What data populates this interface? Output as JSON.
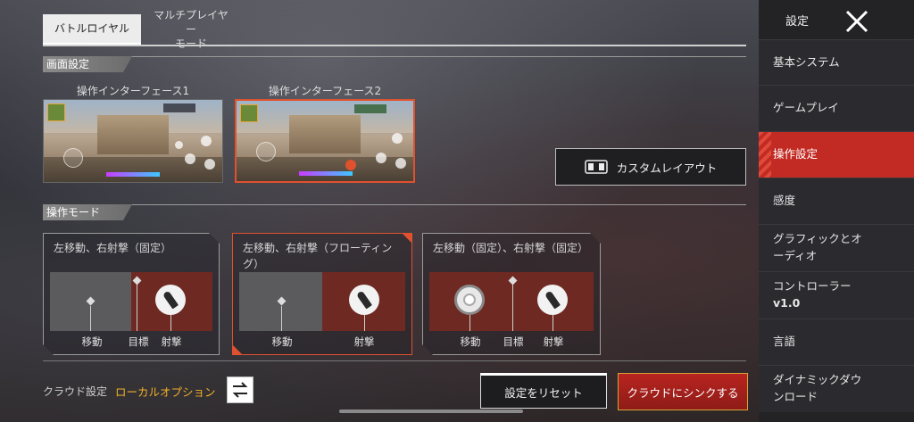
{
  "tabs": [
    {
      "label": "バトルロイヤル",
      "active": true
    },
    {
      "label": "マルチプレイヤー\nモード",
      "active": false
    }
  ],
  "sections": {
    "display": "画面設定",
    "mode": "操作モード"
  },
  "interfaces": [
    {
      "title": "操作インターフェース1",
      "selected": false
    },
    {
      "title": "操作インターフェース2",
      "selected": true
    }
  ],
  "custom_layout": {
    "label": "カスタムレイアウト",
    "icon": "controller-layout-icon"
  },
  "modes": [
    {
      "title": "左移動、右射撃（固定）",
      "selected": false,
      "labels": [
        "移動",
        "目標",
        "射撃"
      ]
    },
    {
      "title": "左移動、右射撃（フローティング）",
      "selected": true,
      "labels": [
        "移動",
        "射撃"
      ]
    },
    {
      "title": "左移動（固定）、右射撃（固定）",
      "selected": false,
      "labels": [
        "移動",
        "目標",
        "射撃"
      ]
    }
  ],
  "cloud": {
    "label": "クラウド設定",
    "value": "ローカルオプション",
    "swap_icon": "swap-arrows-icon"
  },
  "buttons": {
    "reset": "設定をリセット",
    "sync": "クラウドにシンクする"
  },
  "sidebar": {
    "title": "設定",
    "close_icon": "close-icon",
    "items": [
      {
        "label": "基本システム",
        "active": false
      },
      {
        "label": "ゲームプレイ",
        "active": false
      },
      {
        "label": "操作設定",
        "active": true
      },
      {
        "label": "感度",
        "active": false
      },
      {
        "label": "グラフィックとオ\nーディオ",
        "active": false
      },
      {
        "label": "コントローラー",
        "sub": "v1.0",
        "active": false
      },
      {
        "label": "言語",
        "active": false
      },
      {
        "label": "ダイナミックダウ\nンロード",
        "active": false
      }
    ]
  },
  "colors": {
    "accent_red": "#c22b23",
    "highlight_orange": "#e0512d",
    "cloud_value": "#f0b02a"
  }
}
